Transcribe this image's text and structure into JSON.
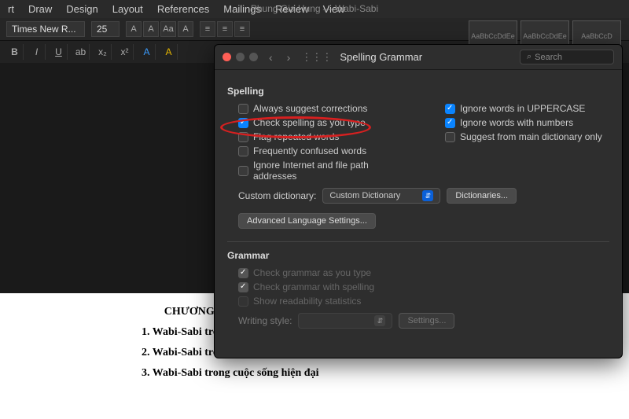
{
  "window": {
    "title": "Phung Gia Hung — Wabi-Sabi"
  },
  "ribbon": {
    "tabs": [
      "rt",
      "Draw",
      "Design",
      "Layout",
      "References",
      "Mailings",
      "Review",
      "View"
    ]
  },
  "toolbar": {
    "font": "Times New R...",
    "size": "25",
    "styles": [
      "AaBbCcDdEe",
      "AaBbCcDdEe",
      "AaBbCcD"
    ]
  },
  "dialog": {
    "title": "Spelling  Grammar",
    "search_placeholder": "Search",
    "spelling": {
      "heading": "Spelling",
      "left": [
        {
          "label": "Always suggest corrections",
          "checked": false
        },
        {
          "label": "Check spelling as you type",
          "checked": true,
          "highlight": true
        },
        {
          "label": "Flag repeated words",
          "checked": false
        },
        {
          "label": "Frequently confused words",
          "checked": false
        },
        {
          "label": "Ignore Internet and file path addresses",
          "checked": false
        }
      ],
      "right": [
        {
          "label": "Ignore words in UPPERCASE",
          "checked": true
        },
        {
          "label": "Ignore words with numbers",
          "checked": true
        },
        {
          "label": "Suggest from main dictionary only",
          "checked": false
        }
      ],
      "custom_label": "Custom dictionary:",
      "custom_value": "Custom Dictionary",
      "dictionaries_btn": "Dictionaries...",
      "advanced_btn": "Advanced Language Settings..."
    },
    "grammar": {
      "heading": "Grammar",
      "opts": [
        {
          "label": "Check grammar as you type",
          "checked": true
        },
        {
          "label": "Check grammar with spelling",
          "checked": true
        },
        {
          "label": "Show readability statistics",
          "checked": false
        }
      ],
      "writing_label": "Writing style:",
      "settings_btn": "Settings..."
    }
  },
  "document": {
    "lines": [
      "CHƯƠNG II : WABI-SABI trong nghệ thuật đời sống Nhật Bản",
      "1. Wabi-Sabi trong văn hoá Nhật Bản",
      "2. Wabi-Sabi trong thẩm mỹ Nhật Bản",
      "3. Wabi-Sabi trong cuộc sống hiện đại"
    ]
  }
}
